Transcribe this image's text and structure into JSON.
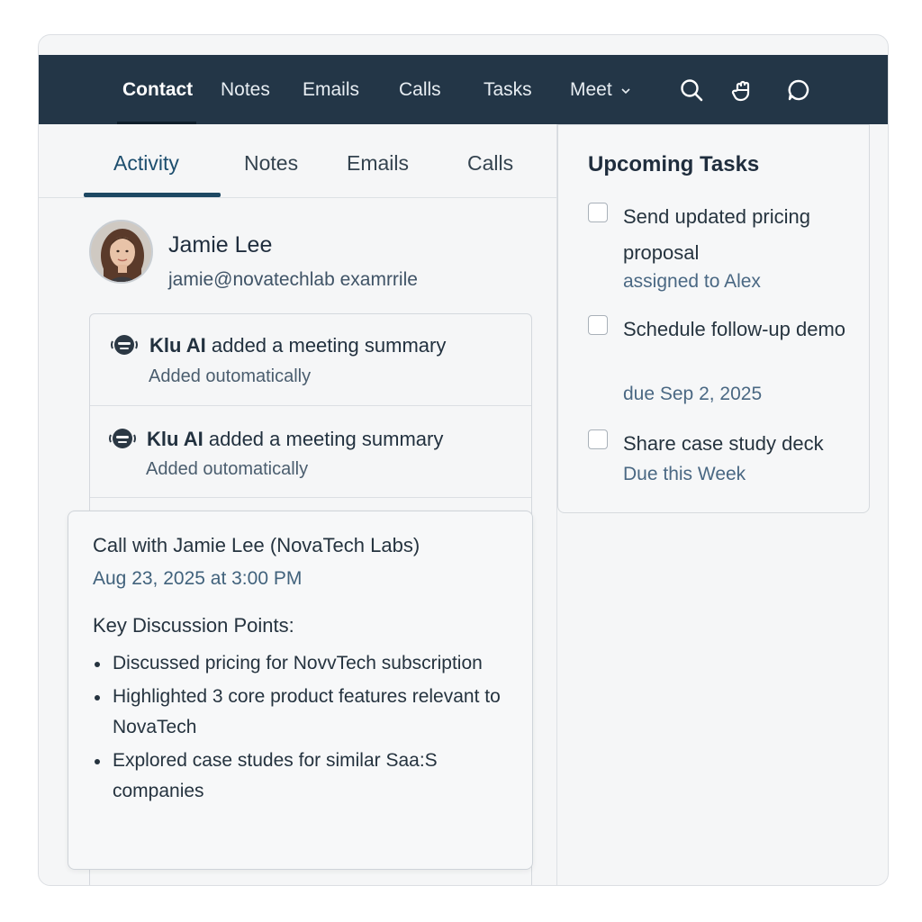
{
  "topnav": {
    "items": [
      "Contact",
      "Notes",
      "Emails",
      "Calls",
      "Tasks",
      "Meet"
    ],
    "active_index": 0,
    "meet_chevron": "chevron-down-icon",
    "icons": [
      "search-icon",
      "hand-icon",
      "chat-icon"
    ]
  },
  "tabs": {
    "items": [
      "Activity",
      "Notes",
      "Emails",
      "Calls"
    ],
    "active_index": 0
  },
  "contact": {
    "name": "Jamie Lee",
    "email": "jamie@novatechlab examrrile"
  },
  "activities": [
    {
      "author": "Klu AI",
      "action": "added a meeting summary",
      "sub": "Added outomatically"
    },
    {
      "author": "Klu AI",
      "action": "added a meeting summary",
      "sub": "Added outomatically"
    }
  ],
  "call_summary": {
    "title": "Call with Jamie Lee (NovaTech Labs)",
    "datetime": "Aug 23, 2025 at 3:00 PM",
    "heading": "Key Discussion Points:",
    "points": [
      "Discussed pricing for NovvTech subscription",
      "Highlighted 3 core product features relevant to NovaTech",
      "Explored case studes for similar Saa:S companies"
    ]
  },
  "upcoming_tasks": {
    "title": "Upcoming Tasks",
    "items": [
      {
        "title": "Send updated pricing proposal",
        "meta": "assigned to Alex",
        "checked": false
      },
      {
        "title": "Schedule follow-up demo",
        "meta": "due Sep 2, 2025",
        "checked": false
      },
      {
        "title": "Share case study deck",
        "meta": "Due this Week",
        "checked": false
      }
    ]
  },
  "colors": {
    "topbar": "#233647",
    "accent": "#1d4863",
    "meta_text": "#4a6883"
  }
}
